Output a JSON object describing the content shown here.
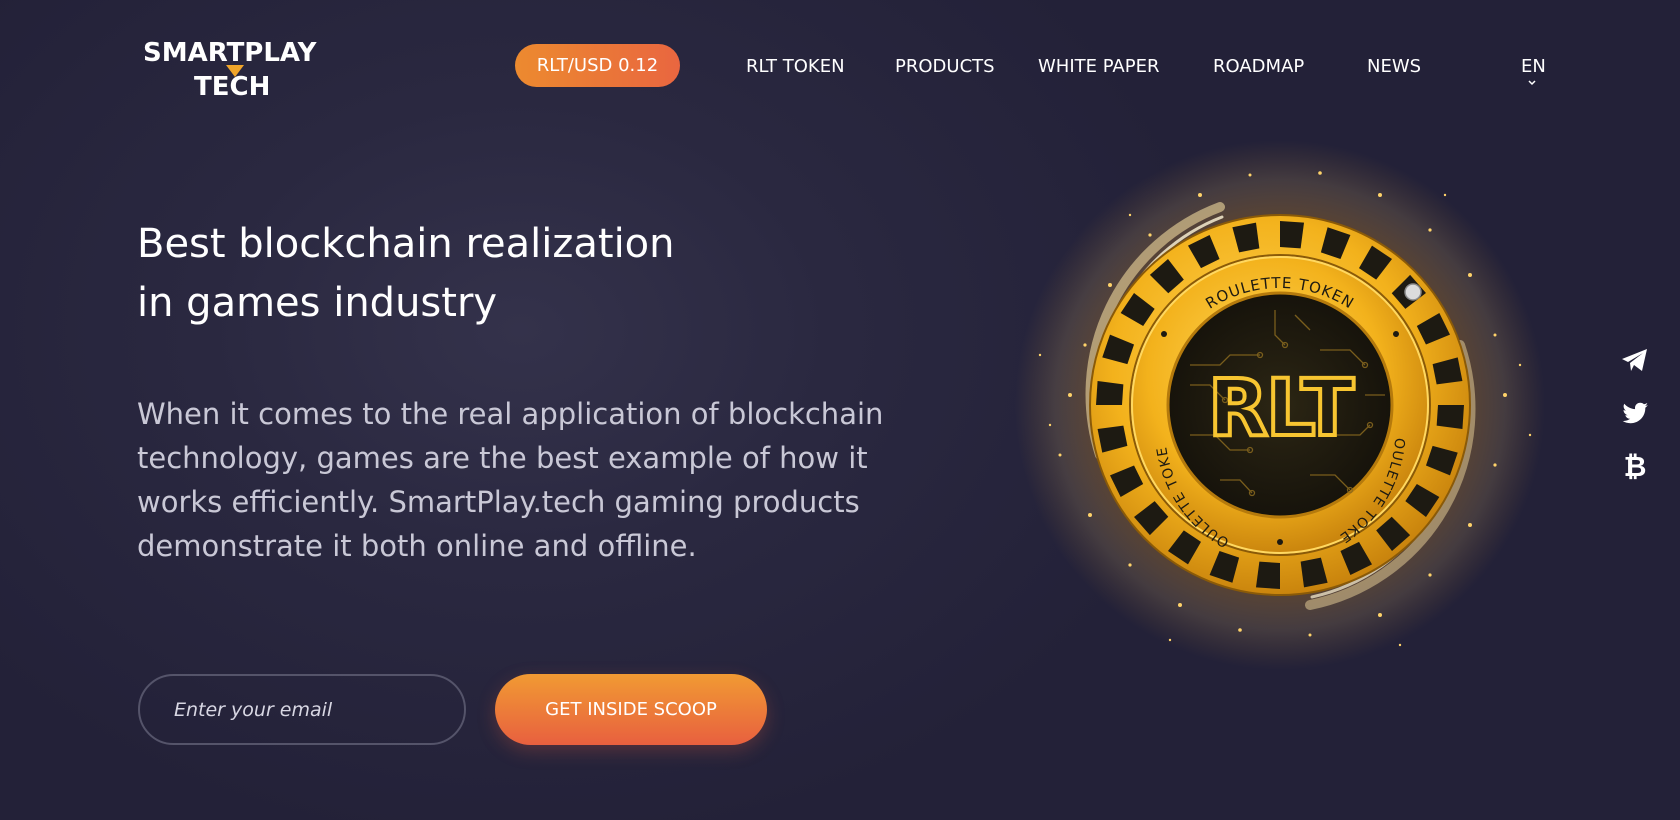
{
  "brand": {
    "logo_line1": "SMARTPLAY",
    "logo_line2": "TECH",
    "accent_color": "#f0a52a"
  },
  "header": {
    "price": "RLT/USD 0.12",
    "nav": [
      {
        "label": "RLT TOKEN"
      },
      {
        "label": "PRODUCTS"
      },
      {
        "label": "WHITE PAPER"
      },
      {
        "label": "ROADMAP"
      },
      {
        "label": "NEWS"
      }
    ],
    "language": "EN"
  },
  "hero": {
    "headline_line1": "Best blockchain realization",
    "headline_line2": "in games industry",
    "description_lines": [
      "When it comes to the real application of blockchain",
      "technology, games are the best example of how it",
      "works efficiently. SmartPlay.tech gaming products",
      "demonstrate it both online and offline."
    ]
  },
  "signup": {
    "email_placeholder": "Enter your email",
    "button_label": "GET INSIDE SCOOP"
  },
  "coin": {
    "ring_text": "ROULETTE TOKEN",
    "center_text": "RLT",
    "gold": "#f3b21c",
    "dark": "#1d1a12"
  },
  "social": {
    "icons": [
      "telegram-icon",
      "twitter-icon",
      "bitcoin-icon"
    ]
  },
  "colors": {
    "background": "#232138",
    "cta_start": "#f19a33",
    "cta_end": "#e8603f",
    "text_muted": "#c9c8d6"
  }
}
